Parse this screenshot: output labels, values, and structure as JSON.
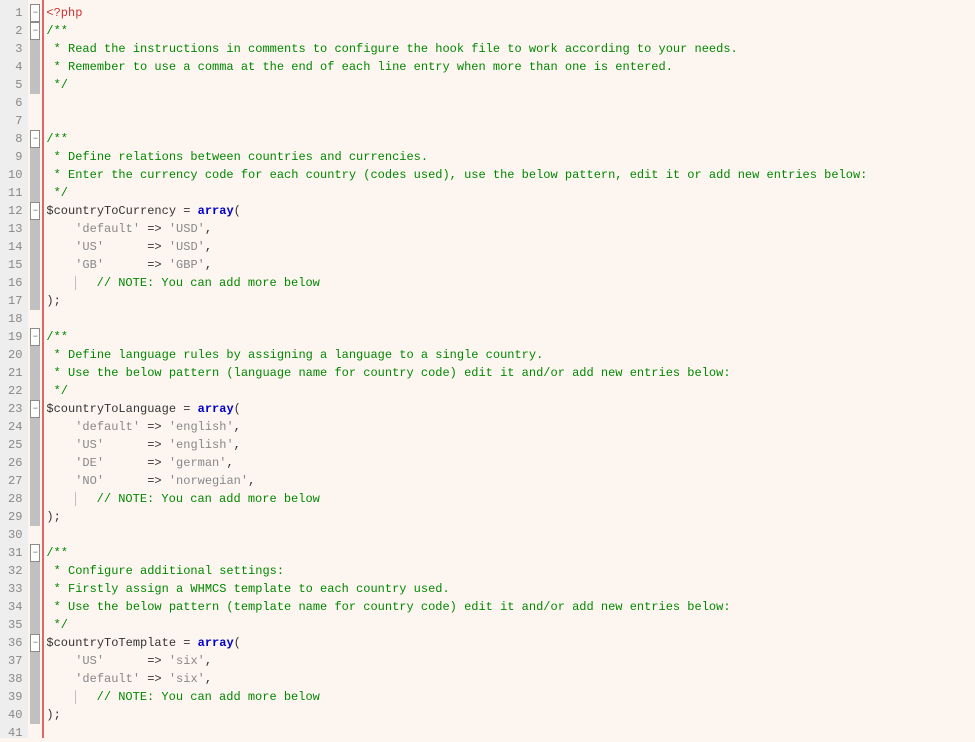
{
  "lineCount": 41,
  "foldMarkers": {
    "1": "minus",
    "2": "minus",
    "8": "minus",
    "12": "minus",
    "19": "minus",
    "23": "minus",
    "31": "minus",
    "36": "minus"
  },
  "code": {
    "l1": {
      "open": "<?php"
    },
    "l2": {
      "comment": "/**"
    },
    "l3": {
      "comment": " * Read the instructions in comments to configure the hook file to work according to your needs."
    },
    "l4": {
      "comment": " * Remember to use a comma at the end of each line entry when more than one is entered."
    },
    "l5": {
      "comment": " */"
    },
    "l6": "",
    "l7": "",
    "l8": {
      "comment": "/**"
    },
    "l9": {
      "comment": " * Define relations between countries and currencies."
    },
    "l10": {
      "comment": " * Enter the currency code for each country (codes used), use the below pattern, edit it or add new entries below:"
    },
    "l11": {
      "comment": " */"
    },
    "l12": {
      "var": "$countryToCurrency",
      "eq": " = ",
      "kw": "array",
      "open": "("
    },
    "l13": {
      "k": "'default'",
      "arrow": " => ",
      "v": "'USD'",
      "c": ","
    },
    "l14": {
      "k": "'US'     ",
      "arrow": " => ",
      "v": "'USD'",
      "c": ","
    },
    "l15": {
      "k": "'GB'     ",
      "arrow": " => ",
      "v": "'GBP'",
      "c": ","
    },
    "l16": {
      "note": "// NOTE: You can add more below"
    },
    "l17": {
      "close": ");"
    },
    "l18": "",
    "l19": {
      "comment": "/**"
    },
    "l20": {
      "comment": " * Define language rules by assigning a language to a single country."
    },
    "l21": {
      "comment": " * Use the below pattern (language name for country code) edit it and/or add new entries below:"
    },
    "l22": {
      "comment": " */"
    },
    "l23": {
      "var": "$countryToLanguage",
      "eq": " = ",
      "kw": "array",
      "open": "("
    },
    "l24": {
      "k": "'default'",
      "arrow": " => ",
      "v": "'english'",
      "c": ","
    },
    "l25": {
      "k": "'US'     ",
      "arrow": " => ",
      "v": "'english'",
      "c": ","
    },
    "l26": {
      "k": "'DE'     ",
      "arrow": " => ",
      "v": "'german'",
      "c": ","
    },
    "l27": {
      "k": "'NO'     ",
      "arrow": " => ",
      "v": "'norwegian'",
      "c": ","
    },
    "l28": {
      "note": "// NOTE: You can add more below"
    },
    "l29": {
      "close": ");"
    },
    "l30": "",
    "l31": {
      "comment": "/**"
    },
    "l32": {
      "comment": " * Configure additional settings:"
    },
    "l33": {
      "comment": " * Firstly assign a WHMCS template to each country used."
    },
    "l34": {
      "comment": " * Use the below pattern (template name for country code) edit it and/or add new entries below:"
    },
    "l35": {
      "comment": " */"
    },
    "l36": {
      "var": "$countryToTemplate",
      "eq": " = ",
      "kw": "array",
      "open": "("
    },
    "l37": {
      "k": "'US'     ",
      "arrow": " => ",
      "v": "'six'",
      "c": ","
    },
    "l38": {
      "k": "'default'",
      "arrow": " => ",
      "v": "'six'",
      "c": ","
    },
    "l39": {
      "note": "// NOTE: You can add more below"
    },
    "l40": {
      "close": ");"
    },
    "l41": ""
  }
}
